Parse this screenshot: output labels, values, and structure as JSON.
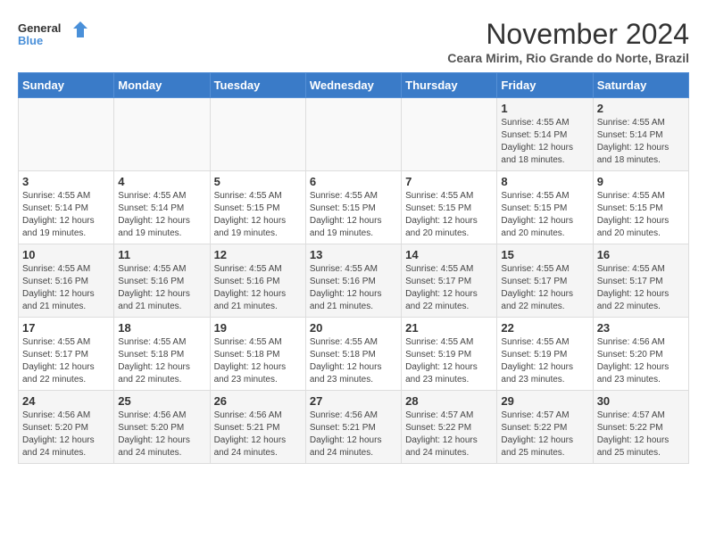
{
  "header": {
    "logo_line1": "General",
    "logo_line2": "Blue",
    "month_title": "November 2024",
    "location": "Ceara Mirim, Rio Grande do Norte, Brazil"
  },
  "weekdays": [
    "Sunday",
    "Monday",
    "Tuesday",
    "Wednesday",
    "Thursday",
    "Friday",
    "Saturday"
  ],
  "weeks": [
    [
      {
        "day": "",
        "info": ""
      },
      {
        "day": "",
        "info": ""
      },
      {
        "day": "",
        "info": ""
      },
      {
        "day": "",
        "info": ""
      },
      {
        "day": "",
        "info": ""
      },
      {
        "day": "1",
        "info": "Sunrise: 4:55 AM\nSunset: 5:14 PM\nDaylight: 12 hours and 18 minutes."
      },
      {
        "day": "2",
        "info": "Sunrise: 4:55 AM\nSunset: 5:14 PM\nDaylight: 12 hours and 18 minutes."
      }
    ],
    [
      {
        "day": "3",
        "info": "Sunrise: 4:55 AM\nSunset: 5:14 PM\nDaylight: 12 hours and 19 minutes."
      },
      {
        "day": "4",
        "info": "Sunrise: 4:55 AM\nSunset: 5:14 PM\nDaylight: 12 hours and 19 minutes."
      },
      {
        "day": "5",
        "info": "Sunrise: 4:55 AM\nSunset: 5:15 PM\nDaylight: 12 hours and 19 minutes."
      },
      {
        "day": "6",
        "info": "Sunrise: 4:55 AM\nSunset: 5:15 PM\nDaylight: 12 hours and 19 minutes."
      },
      {
        "day": "7",
        "info": "Sunrise: 4:55 AM\nSunset: 5:15 PM\nDaylight: 12 hours and 20 minutes."
      },
      {
        "day": "8",
        "info": "Sunrise: 4:55 AM\nSunset: 5:15 PM\nDaylight: 12 hours and 20 minutes."
      },
      {
        "day": "9",
        "info": "Sunrise: 4:55 AM\nSunset: 5:15 PM\nDaylight: 12 hours and 20 minutes."
      }
    ],
    [
      {
        "day": "10",
        "info": "Sunrise: 4:55 AM\nSunset: 5:16 PM\nDaylight: 12 hours and 21 minutes."
      },
      {
        "day": "11",
        "info": "Sunrise: 4:55 AM\nSunset: 5:16 PM\nDaylight: 12 hours and 21 minutes."
      },
      {
        "day": "12",
        "info": "Sunrise: 4:55 AM\nSunset: 5:16 PM\nDaylight: 12 hours and 21 minutes."
      },
      {
        "day": "13",
        "info": "Sunrise: 4:55 AM\nSunset: 5:16 PM\nDaylight: 12 hours and 21 minutes."
      },
      {
        "day": "14",
        "info": "Sunrise: 4:55 AM\nSunset: 5:17 PM\nDaylight: 12 hours and 22 minutes."
      },
      {
        "day": "15",
        "info": "Sunrise: 4:55 AM\nSunset: 5:17 PM\nDaylight: 12 hours and 22 minutes."
      },
      {
        "day": "16",
        "info": "Sunrise: 4:55 AM\nSunset: 5:17 PM\nDaylight: 12 hours and 22 minutes."
      }
    ],
    [
      {
        "day": "17",
        "info": "Sunrise: 4:55 AM\nSunset: 5:17 PM\nDaylight: 12 hours and 22 minutes."
      },
      {
        "day": "18",
        "info": "Sunrise: 4:55 AM\nSunset: 5:18 PM\nDaylight: 12 hours and 22 minutes."
      },
      {
        "day": "19",
        "info": "Sunrise: 4:55 AM\nSunset: 5:18 PM\nDaylight: 12 hours and 23 minutes."
      },
      {
        "day": "20",
        "info": "Sunrise: 4:55 AM\nSunset: 5:18 PM\nDaylight: 12 hours and 23 minutes."
      },
      {
        "day": "21",
        "info": "Sunrise: 4:55 AM\nSunset: 5:19 PM\nDaylight: 12 hours and 23 minutes."
      },
      {
        "day": "22",
        "info": "Sunrise: 4:55 AM\nSunset: 5:19 PM\nDaylight: 12 hours and 23 minutes."
      },
      {
        "day": "23",
        "info": "Sunrise: 4:56 AM\nSunset: 5:20 PM\nDaylight: 12 hours and 23 minutes."
      }
    ],
    [
      {
        "day": "24",
        "info": "Sunrise: 4:56 AM\nSunset: 5:20 PM\nDaylight: 12 hours and 24 minutes."
      },
      {
        "day": "25",
        "info": "Sunrise: 4:56 AM\nSunset: 5:20 PM\nDaylight: 12 hours and 24 minutes."
      },
      {
        "day": "26",
        "info": "Sunrise: 4:56 AM\nSunset: 5:21 PM\nDaylight: 12 hours and 24 minutes."
      },
      {
        "day": "27",
        "info": "Sunrise: 4:56 AM\nSunset: 5:21 PM\nDaylight: 12 hours and 24 minutes."
      },
      {
        "day": "28",
        "info": "Sunrise: 4:57 AM\nSunset: 5:22 PM\nDaylight: 12 hours and 24 minutes."
      },
      {
        "day": "29",
        "info": "Sunrise: 4:57 AM\nSunset: 5:22 PM\nDaylight: 12 hours and 25 minutes."
      },
      {
        "day": "30",
        "info": "Sunrise: 4:57 AM\nSunset: 5:22 PM\nDaylight: 12 hours and 25 minutes."
      }
    ]
  ]
}
